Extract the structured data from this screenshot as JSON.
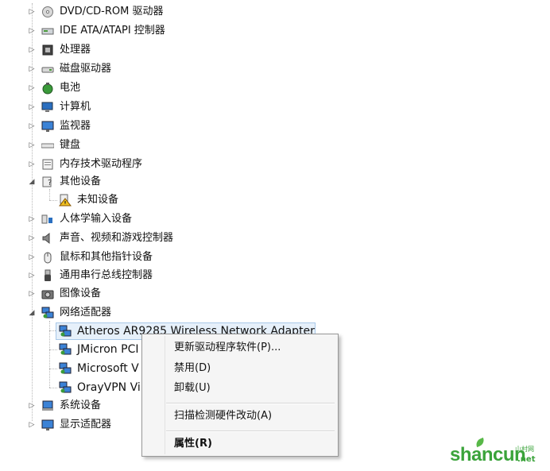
{
  "tree": {
    "items": [
      {
        "label": "DVD/CD-ROM 驱动器",
        "icon": "dvd-drive-icon"
      },
      {
        "label": "IDE ATA/ATAPI 控制器",
        "icon": "ide-controller-icon"
      },
      {
        "label": "处理器",
        "icon": "processor-icon"
      },
      {
        "label": "磁盘驱动器",
        "icon": "disk-drive-icon"
      },
      {
        "label": "电池",
        "icon": "battery-icon"
      },
      {
        "label": "计算机",
        "icon": "computer-icon"
      },
      {
        "label": "监视器",
        "icon": "monitor-icon"
      },
      {
        "label": "键盘",
        "icon": "keyboard-icon"
      },
      {
        "label": "内存技术驱动程序",
        "icon": "memory-technology-icon"
      },
      {
        "label": "其他设备",
        "icon": "other-devices-icon",
        "expanded": true
      },
      {
        "label": "未知设备",
        "icon": "unknown-device-warning-icon",
        "child": true
      },
      {
        "label": "人体学输入设备",
        "icon": "hid-icon"
      },
      {
        "label": "声音、视频和游戏控制器",
        "icon": "sound-icon"
      },
      {
        "label": "鼠标和其他指针设备",
        "icon": "mouse-icon"
      },
      {
        "label": "通用串行总线控制器",
        "icon": "usb-icon"
      },
      {
        "label": "图像设备",
        "icon": "camera-icon"
      },
      {
        "label": "网络适配器",
        "icon": "network-adapter-icon",
        "expanded": true
      },
      {
        "label": "Atheros AR9285 Wireless Network Adapter",
        "icon": "network-adapter-icon",
        "child": true,
        "selected": true
      },
      {
        "label": "JMicron PCI",
        "icon": "network-adapter-icon",
        "child": true
      },
      {
        "label": "Microsoft V",
        "icon": "network-adapter-icon",
        "child": true
      },
      {
        "label": "OrayVPN Vi",
        "icon": "network-adapter-icon",
        "child": true
      },
      {
        "label": "系统设备",
        "icon": "system-devices-icon"
      },
      {
        "label": "显示适配器",
        "icon": "display-adapter-icon"
      }
    ]
  },
  "context_menu": {
    "update_driver": "更新驱动程序软件(P)...",
    "disable": "禁用(D)",
    "uninstall": "卸载(U)",
    "scan": "扫描检测硬件改动(A)",
    "properties": "属性(R)"
  },
  "watermark": {
    "brand": "shancun",
    "sub": "山村网",
    "tld": ".net"
  },
  "colors": {
    "selection": "#e6f0fa",
    "menu_bg": "#f5f5f5",
    "watermark": "#3aa33a"
  }
}
